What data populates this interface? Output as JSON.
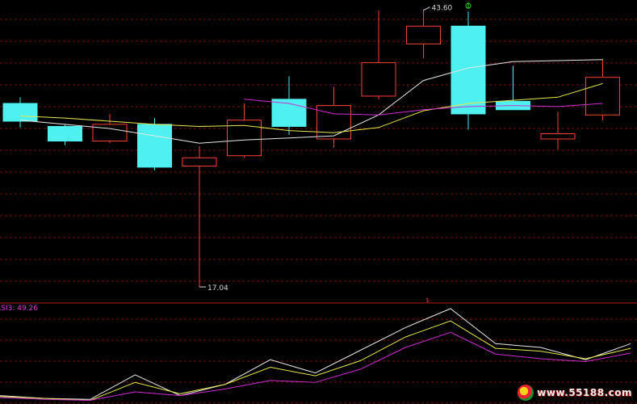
{
  "chart_data": {
    "type": "candlestick",
    "price_range": [
      15.5,
      44.5
    ],
    "candles": [
      {
        "open": 34.6,
        "high": 35.2,
        "low": 32.3,
        "close": 32.9
      },
      {
        "open": 32.4,
        "high": 32.6,
        "low": 30.6,
        "close": 31.0
      },
      {
        "open": 31.0,
        "high": 33.6,
        "low": 30.8,
        "close": 32.6
      },
      {
        "open": 32.6,
        "high": 33.2,
        "low": 28.2,
        "close": 28.5
      },
      {
        "open": 28.6,
        "high": 30.5,
        "low": 17.04,
        "close": 29.4
      },
      {
        "open": 29.6,
        "high": 34.6,
        "low": 29.4,
        "close": 33.0
      },
      {
        "open": 35.0,
        "high": 37.2,
        "low": 31.6,
        "close": 32.4
      },
      {
        "open": 31.2,
        "high": 36.2,
        "low": 30.4,
        "close": 34.4
      },
      {
        "open": 35.3,
        "high": 43.5,
        "low": 35.0,
        "close": 38.5
      },
      {
        "open": 40.3,
        "high": 43.6,
        "low": 38.9,
        "close": 42.0
      },
      {
        "open": 42.0,
        "high": 43.4,
        "low": 32.1,
        "close": 33.6
      },
      {
        "open": 34.8,
        "high": 38.2,
        "low": 34.6,
        "close": 34.0
      },
      {
        "open": 31.2,
        "high": 33.8,
        "low": 30.2,
        "close": 31.7
      },
      {
        "open": 33.5,
        "high": 38.8,
        "low": 33.0,
        "close": 37.1
      }
    ],
    "ma_lines": [
      {
        "color": "#e8e8e8",
        "values": [
          33.0,
          32.6,
          32.2,
          31.5,
          30.8,
          31.1,
          31.3,
          31.5,
          33.5,
          36.8,
          38.0,
          38.6,
          38.7,
          38.8
        ]
      },
      {
        "color": "#e8e84a",
        "values": [
          33.4,
          33.2,
          32.9,
          32.6,
          32.4,
          32.5,
          32.0,
          31.8,
          32.3,
          33.9,
          34.6,
          34.9,
          35.2,
          36.5
        ]
      },
      {
        "color": "#d030d0",
        "values": [
          null,
          null,
          null,
          null,
          null,
          35.0,
          34.6,
          33.6,
          33.5,
          34.0,
          34.3,
          34.4,
          34.3,
          34.6
        ]
      }
    ],
    "annotations": {
      "high_label": "43.60",
      "low_label": "17.04"
    },
    "rsi": {
      "label": "RSI3: 49.26",
      "range": [
        0,
        100
      ],
      "series": [
        {
          "color": "#e8e8e8",
          "values": [
            8,
            5,
            4,
            30,
            8,
            20,
            46,
            32,
            56,
            80,
            100,
            63,
            59,
            46,
            63
          ]
        },
        {
          "color": "#e8e84a",
          "values": [
            7,
            5,
            3,
            22,
            10,
            20,
            38,
            29,
            45,
            70,
            87,
            58,
            55,
            47,
            58
          ]
        },
        {
          "color": "#d030d0",
          "values": [
            6,
            4,
            3,
            12,
            8,
            15,
            24,
            22,
            36,
            59,
            75,
            52,
            47,
            44,
            53
          ]
        }
      ]
    }
  },
  "watermark": {
    "text": "www.55188.com"
  }
}
